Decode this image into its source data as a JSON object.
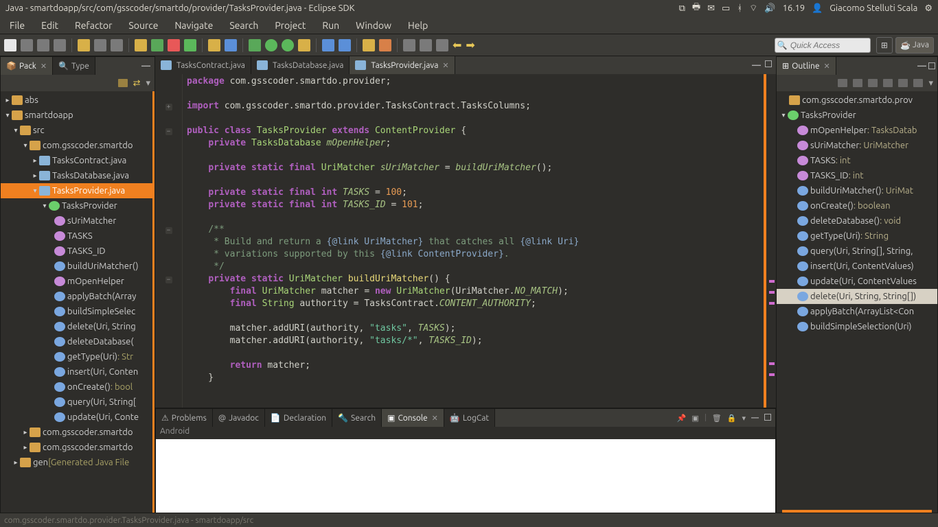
{
  "window": {
    "title": "Java - smartdoapp/src/com/gsscoder/smartdo/provider/TasksProvider.java - Eclipse SDK",
    "time": "16.19",
    "user": "Giacomo Stelluti Scala"
  },
  "menu": [
    "File",
    "Edit",
    "Refactor",
    "Source",
    "Navigate",
    "Search",
    "Project",
    "Run",
    "Window",
    "Help"
  ],
  "quick_access_placeholder": "Quick Access",
  "perspectives": {
    "java": "Java"
  },
  "left_panel": {
    "tabs": {
      "pack": "Pack",
      "type": "Type"
    },
    "tree": {
      "abs": "abs",
      "smartdoapp": "smartdoapp",
      "src": "src",
      "pkg1": "com.gsscoder.smartdo",
      "f_contract": "TasksContract.java",
      "f_db": "TasksDatabase.java",
      "f_provider": "TasksProvider.java",
      "cls_provider": "TasksProvider",
      "m_sUriMatcher": "sUriMatcher",
      "m_TASKS": "TASKS",
      "m_TASKS_ID": "TASKS_ID",
      "m_buildUriMatcher": "buildUriMatcher()",
      "m_mOpenHelper": "mOpenHelper",
      "m_applyBatch": "applyBatch(Array",
      "m_buildSimpleSelect": "buildSimpleSelec",
      "m_delete": "delete(Uri, String",
      "m_deleteDatabase": "deleteDatabase(",
      "m_getType": "getType(Uri)",
      "m_getType_sig": ": Str",
      "m_insert": "insert(Uri, Conten",
      "m_onCreate": "onCreate()",
      "m_onCreate_sig": ": bool",
      "m_query": "query(Uri, String[",
      "m_update": "update(Uri, Conte",
      "pkg2": "com.gsscoder.smartdo",
      "pkg3": "com.gsscoder.smartdo",
      "gen": "gen",
      "gen_note": "[Generated Java File"
    }
  },
  "editor": {
    "tabs": {
      "contract": "TasksContract.java",
      "db": "TasksDatabase.java",
      "provider": "TasksProvider.java"
    },
    "code": {
      "pkg": "package",
      "pkg_val": "com.gsscoder.smartdo.provider;",
      "imp": "import",
      "imp_val": "com.gsscoder.smartdo.provider.TasksContract.TasksColumns;",
      "public": "public",
      "class": "class",
      "TasksProvider": "TasksProvider",
      "extends": "extends",
      "ContentProvider": "ContentProvider",
      "private": "private",
      "static": "static",
      "final": "final",
      "int": "int",
      "new": "new",
      "return": "return",
      "TasksDatabase": "TasksDatabase",
      "mOpenHelper": "mOpenHelper",
      "UriMatcher": "UriMatcher",
      "sUriMatcher": "sUriMatcher",
      "buildUriMatcher": "buildUriMatcher",
      "TASKS": "TASKS",
      "n100": "100",
      "TASKS_ID": "TASKS_ID",
      "n101": "101",
      "c1": "/**",
      "c2": " * Build and return a ",
      "c2a": "{@link UriMatcher}",
      "c2b": " that catches all ",
      "c2c": "{@link Uri}",
      "c3": " * variations supported by this ",
      "c3a": "{@link ContentProvider}",
      "c3b": ".",
      "c4": " */",
      "matcher": "matcher",
      "String": "String",
      "authority": "authority",
      "TasksContract": "TasksContract",
      "CONTENT_AUTHORITY": "CONTENT_AUTHORITY",
      "NO_MATCH": "NO_MATCH",
      "addURI": "addURI",
      "str_tasks": "\"tasks\"",
      "str_tasks_star": "\"tasks/*\""
    }
  },
  "bottom": {
    "tabs": {
      "problems": "Problems",
      "javadoc": "Javadoc",
      "declaration": "Declaration",
      "search": "Search",
      "console": "Console",
      "logcat": "LogCat"
    },
    "console_head": "Android"
  },
  "outline": {
    "title": "Outline",
    "items": {
      "pkg": "com.gsscoder.smartdo.prov",
      "cls": "TasksProvider",
      "mOpenHelper": "mOpenHelper",
      "mOpenHelper_sig": " : TasksDatab",
      "sUriMatcher": "sUriMatcher",
      "sUriMatcher_sig": " : UriMatcher",
      "TASKS": "TASKS",
      "TASKS_sig": " : int",
      "TASKS_ID": "TASKS_ID",
      "TASKS_ID_sig": " : int",
      "buildUriMatcher": "buildUriMatcher()",
      "buildUriMatcher_sig": " : UriMat",
      "onCreate": "onCreate()",
      "onCreate_sig": " : boolean",
      "deleteDatabase": "deleteDatabase()",
      "deleteDatabase_sig": " : void",
      "getType": "getType(Uri)",
      "getType_sig": " : String",
      "query": "query(Uri, String[], String, ",
      "insert": "insert(Uri, ContentValues)",
      "update": "update(Uri, ContentValues",
      "delete": "delete(Uri, String, String[])",
      "applyBatch": "applyBatch(ArrayList<Con",
      "buildSimpleSelection": "buildSimpleSelection(Uri)"
    }
  },
  "status": "com.gsscoder.smartdo.provider.TasksProvider.java - smartdoapp/src"
}
